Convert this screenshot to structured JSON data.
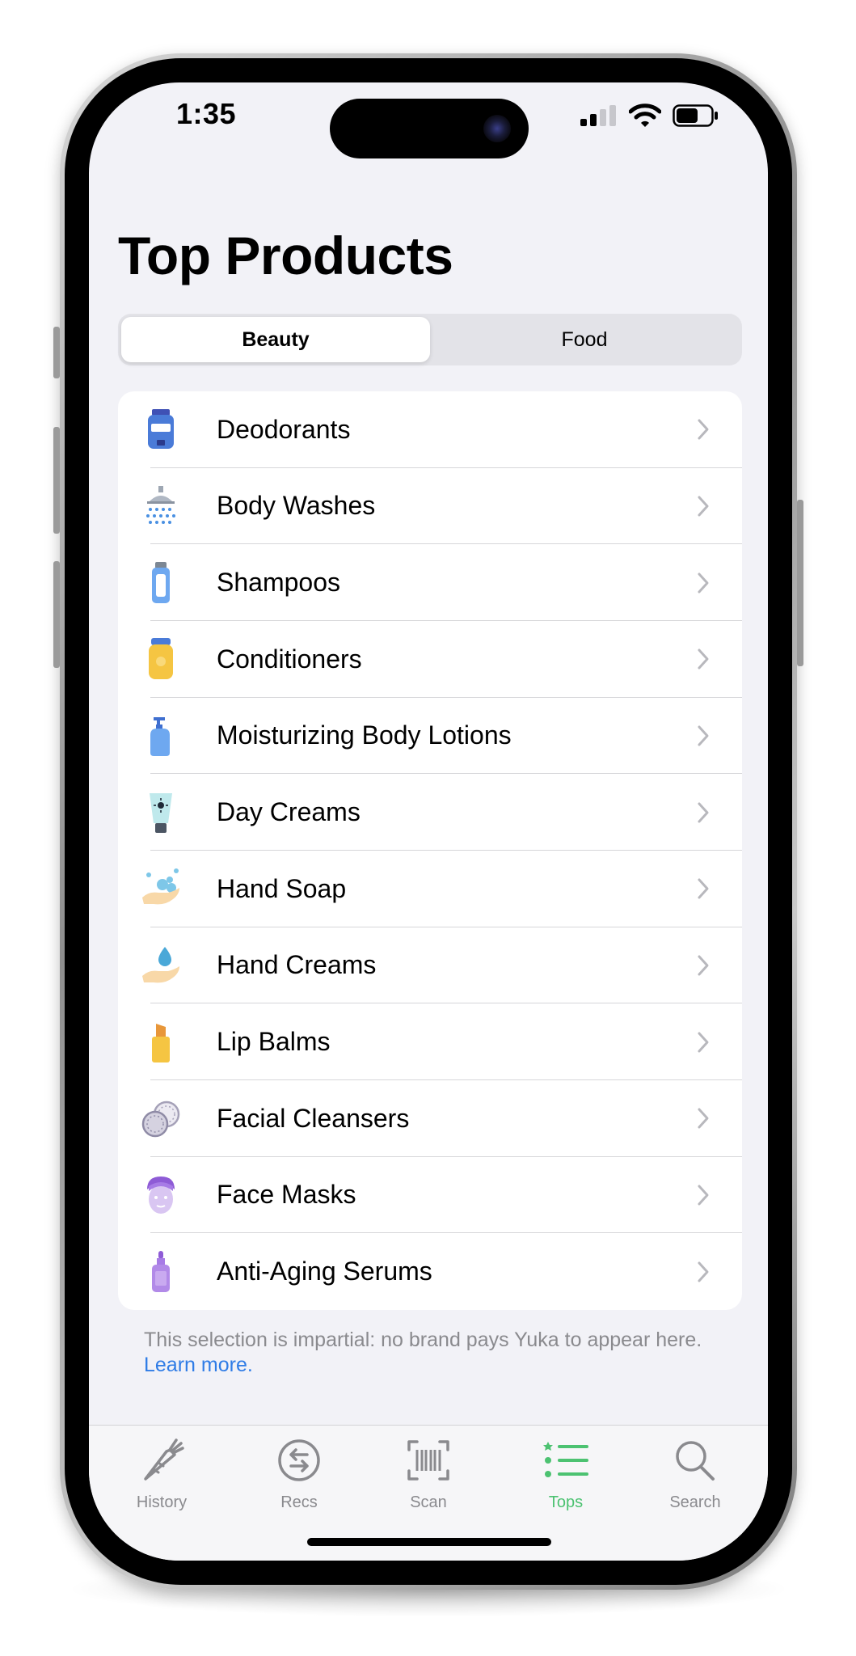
{
  "status_bar": {
    "time": "1:35",
    "icons": [
      "cellular-signal-icon",
      "wifi-icon",
      "battery-icon"
    ]
  },
  "header": {
    "title": "Top Products"
  },
  "segments": [
    {
      "label": "Beauty",
      "selected": true
    },
    {
      "label": "Food",
      "selected": false
    }
  ],
  "categories": [
    {
      "label": "Deodorants",
      "icon": "deodorant-icon"
    },
    {
      "label": "Body Washes",
      "icon": "shower-icon"
    },
    {
      "label": "Shampoos",
      "icon": "shampoo-bottle-icon"
    },
    {
      "label": "Conditioners",
      "icon": "conditioner-bottle-icon"
    },
    {
      "label": "Moisturizing Body Lotions",
      "icon": "lotion-pump-icon"
    },
    {
      "label": "Day Creams",
      "icon": "day-cream-tube-icon"
    },
    {
      "label": "Hand Soap",
      "icon": "hand-soap-icon"
    },
    {
      "label": "Hand Creams",
      "icon": "hand-cream-icon"
    },
    {
      "label": "Lip Balms",
      "icon": "lip-balm-icon"
    },
    {
      "label": "Facial Cleansers",
      "icon": "cotton-pads-icon"
    },
    {
      "label": "Face Masks",
      "icon": "face-mask-icon"
    },
    {
      "label": "Anti-Aging Serums",
      "icon": "serum-dropper-icon"
    }
  ],
  "footer": {
    "note": "This selection is impartial: no brand pays Yuka to appear here.",
    "link": "Learn more."
  },
  "tabbar": {
    "items": [
      {
        "label": "History",
        "icon": "carrot-icon",
        "active": false
      },
      {
        "label": "Recs",
        "icon": "swap-arrows-icon",
        "active": false
      },
      {
        "label": "Scan",
        "icon": "barcode-scan-icon",
        "active": false
      },
      {
        "label": "Tops",
        "icon": "ranked-list-icon",
        "active": true
      },
      {
        "label": "Search",
        "icon": "search-icon",
        "active": false
      }
    ]
  },
  "colors": {
    "accent_green": "#4cc271",
    "link_blue": "#2f7ce6",
    "background": "#f2f2f7"
  }
}
